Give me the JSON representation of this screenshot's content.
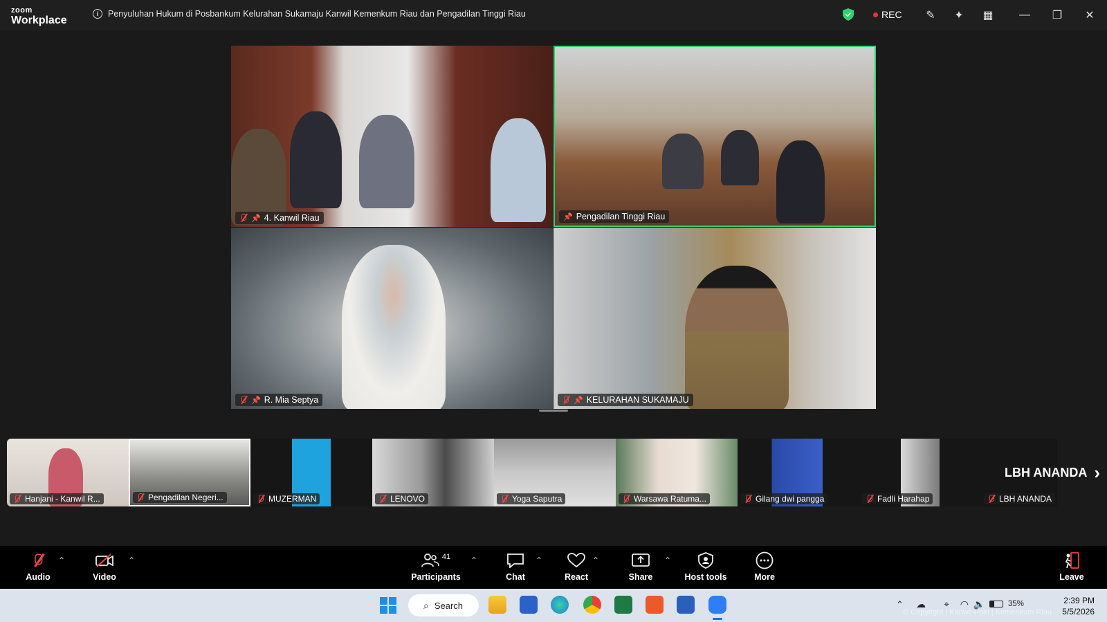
{
  "app": {
    "brand_top": "zoom",
    "brand_bottom": "Workplace"
  },
  "meeting": {
    "title": "Penyuluhan Hukum di Posbankum Kelurahan Sukamaju Kanwil Kemenkum Riau dan Pengadilan Tinggi Riau",
    "rec_label": "REC"
  },
  "tiles": [
    {
      "name": "4. Kanwil Riau"
    },
    {
      "name": "Pengadilan Tinggi Riau"
    },
    {
      "name": "R. Mia Septya"
    },
    {
      "name": "KELURAHAN SUKAMAJU"
    }
  ],
  "strip": [
    {
      "name": "Hanjani - Kanwil R..."
    },
    {
      "name": "Pengadilan Negeri..."
    },
    {
      "name": "MUZERMAN"
    },
    {
      "name": "LENOVO"
    },
    {
      "name": "Yoga Saputra"
    },
    {
      "name": "Warsawa Ratuma..."
    },
    {
      "name": "Gilang dwi pangga"
    },
    {
      "name": "Fadli Harahap"
    },
    {
      "name": "LBH ANANDA"
    }
  ],
  "strip_next_label": "LBH ANANDA",
  "toolbar": {
    "audio": "Audio",
    "video": "Video",
    "participants": "Participants",
    "participants_count": "41",
    "chat": "Chat",
    "react": "React",
    "share": "Share",
    "host_tools": "Host tools",
    "more": "More",
    "leave": "Leave"
  },
  "taskbar": {
    "search": "Search",
    "battery": "35%",
    "time": "2:39 PM",
    "date": "5/5/2026"
  },
  "watermark": "© Copyright | Kanwil Polri | Kemenkum Riau"
}
